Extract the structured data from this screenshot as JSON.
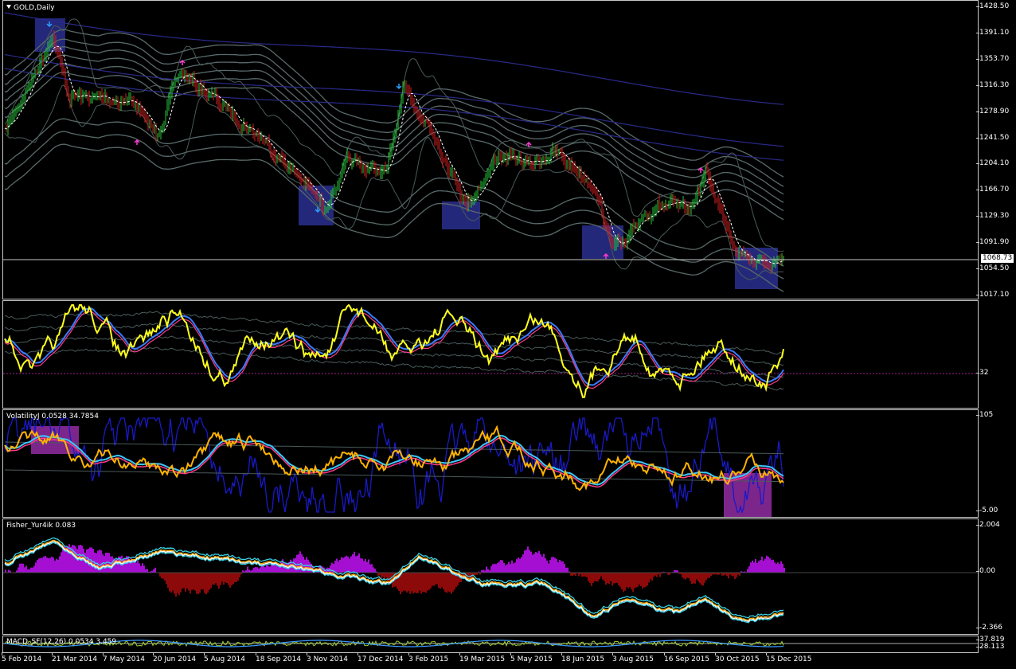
{
  "window": {
    "title": "GOLD,Daily"
  },
  "price_scale": [
    "1428.50",
    "1391.10",
    "1353.70",
    "1316.30",
    "1278.90",
    "1241.50",
    "1204.10",
    "1166.70",
    "1129.30",
    "1091.90",
    "1054.50",
    "1017.10"
  ],
  "current_price": "1068.73",
  "indicators": {
    "osc1": {
      "label": "",
      "scale": [
        "32"
      ]
    },
    "osc2": {
      "label": "VolatilityJ 0.0528 34.7854",
      "scale": [
        "105",
        "-5.00"
      ]
    },
    "fisher": {
      "label": "Fisher_Yur4ik 0.083",
      "scale": [
        "2.004",
        "0.00",
        "-2.366"
      ]
    },
    "osc4": {
      "label": "MACD_SF(12,26) 0.0534 3.459",
      "scale": [
        "37.819",
        "28.113"
      ]
    }
  },
  "time_axis": [
    "5 Feb 2014",
    "21 Mar 2014",
    "7 May 2014",
    "20 Jun 2014",
    "5 Aug 2014",
    "18 Sep 2014",
    "3 Nov 2014",
    "17 Dec 2014",
    "3 Feb 2015",
    "19 Mar 2015",
    "5 May 2015",
    "18 Jun 2015",
    "3 Aug 2015",
    "16 Sep 2015",
    "30 Oct 2015",
    "15 Dec 2015"
  ],
  "colors": {
    "background": "#000000",
    "bull_candle": "#27c73a",
    "bear_candle": "#d41f1f",
    "highlight_box": "#2a2f8f",
    "osc_yellow": "#ffff1e",
    "volatility_orange": "#ffb300",
    "volatility_blue": "#1919c8",
    "fisher_positive": "#a50fd2",
    "fisher_negative": "#8c0a0a",
    "fisher_line": "#3ad2e6"
  }
}
